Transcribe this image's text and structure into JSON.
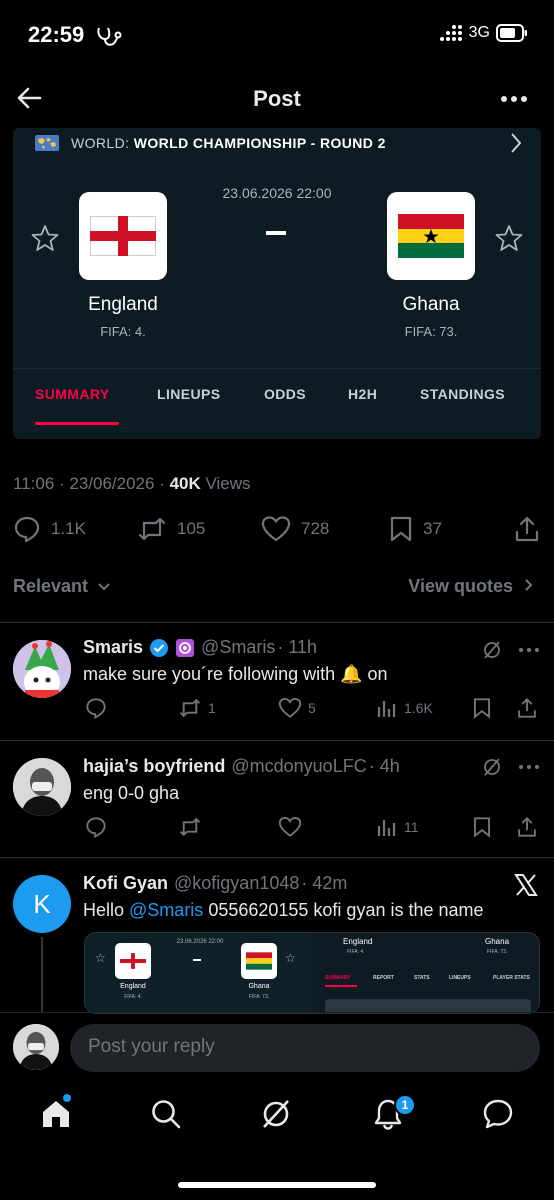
{
  "status": {
    "time": "22:59",
    "network": "3G"
  },
  "header": {
    "title": "Post"
  },
  "match": {
    "competition_prefix": "WORLD:",
    "competition": "WORLD CHAMPIONSHIP - ROUND 2",
    "datetime": "23.06.2026 22:00",
    "score": "-",
    "home": {
      "name": "England",
      "rank": "FIFA: 4."
    },
    "away": {
      "name": "Ghana",
      "rank": "FIFA: 73."
    },
    "tabs": [
      "SUMMARY",
      "LINEUPS",
      "ODDS",
      "H2H",
      "STANDINGS"
    ]
  },
  "post": {
    "timestamp": "11:06 · 23/06/2026 · ",
    "views_count": "40K",
    "views_label": " Views",
    "replies": "1.1K",
    "reposts": "105",
    "likes": "728",
    "bookmarks": "37"
  },
  "sort": {
    "label": "Relevant",
    "quotes": "View quotes"
  },
  "replies": [
    {
      "name": "Smaris",
      "handle": "@Smaris",
      "time": "· 11h",
      "text_before": "make sure you´re following with ",
      "text_after": " on",
      "reposts": "1",
      "likes": "5",
      "views": "1.6K"
    },
    {
      "name": "hajia’s boyfriend",
      "handle": "@mcdonyuoLFC",
      "time": "· 4h",
      "text": "eng 0-0 gha",
      "views": "11"
    },
    {
      "name": "Kofi Gyan",
      "handle": "@kofigyan1048",
      "time": "· 42m",
      "text_before": "Hello ",
      "mention": "@Smaris",
      "text_after": " 0556620155 kofi gyan is the name",
      "avatar_letter": "K",
      "preview": {
        "datetime": "23.06.2026 22:00",
        "home": "England",
        "home_rank": "FIFA: 4.",
        "away": "Ghana",
        "away_rank": "FIFA: 73.",
        "tabs": [
          "SUMMARY",
          "REPORT",
          "STATS",
          "LINEUPS",
          "PLAYER STATS"
        ]
      }
    }
  ],
  "composer": {
    "placeholder": "Post your reply"
  },
  "nav": {
    "notifications_badge": "1"
  },
  "colors": {
    "accent": "#1d9bf0",
    "brand_red": "#ff0046",
    "card_bg": "#0d1b22"
  }
}
